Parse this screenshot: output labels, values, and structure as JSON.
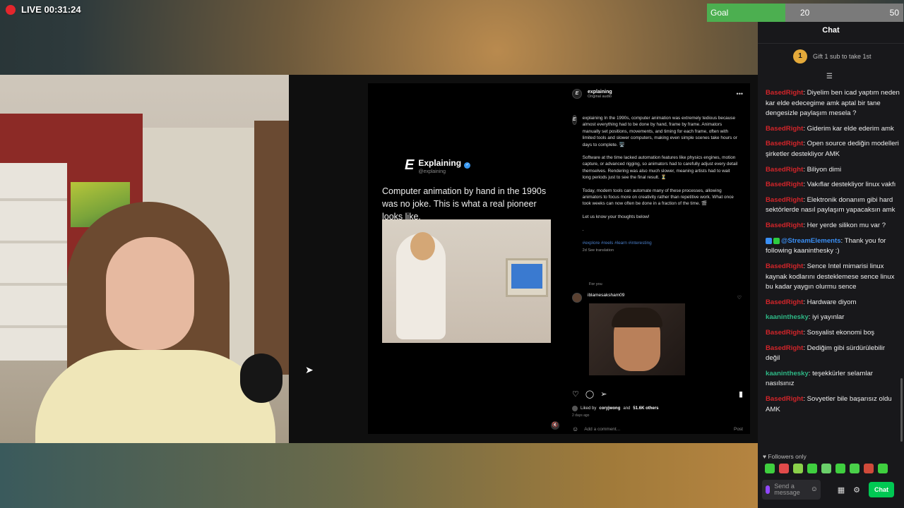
{
  "live": {
    "text": "LIVE 00:31:24",
    "color": "#e3262c"
  },
  "goal": {
    "label": "Goal",
    "current": "20",
    "max": "50",
    "progress": 0.4,
    "color": "#4caf50"
  },
  "instagram": {
    "reel": {
      "brand_logo": "E",
      "brand_name": "Explaining",
      "brand_handle": "@explaining",
      "caption": "Computer animation by hand in the 1990s was no joke. This is what a real pioneer looks like."
    },
    "post": {
      "user": "explaining",
      "audio": "Original audio",
      "paragraphs": [
        "explaining In the 1990s, computer animation was extremely tedious because almost everything had to be done by hand, frame by frame. Animators manually set positions, movements, and timing for each frame, often with limited tools and slower computers, making even simple scenes take hours or days to complete. 🖥️",
        "Software at the time lacked automation features like physics engines, motion capture, or advanced rigging, so animators had to carefully adjust every detail themselves. Rendering was also much slower, meaning artists had to wait long periods just to see the final result. ⏳",
        "Today, modern tools can automate many of these processes, allowing animators to focus more on creativity rather than repetitive work. What once took weeks can now often be done in a fraction of the time. 🎬",
        "Let us know your thoughts below!",
        "."
      ],
      "tags": "#explore #reels #learn #interesting",
      "meta": "2d   See translation",
      "for_you": "For you",
      "reply_user": "iblamesaksham09",
      "liked_prefix": "Liked by",
      "liked_user": "coryjwong",
      "liked_and": "and",
      "liked_others": "51.6K others",
      "date": "2 days ago",
      "comment_placeholder": "Add a comment...",
      "post_label": "Post"
    }
  },
  "chat": {
    "title": "Chat",
    "gift_rank": "1",
    "gift_text": "Gift 1 sub to take 1st",
    "messages": [
      {
        "user": "BasedRight",
        "color": "red",
        "text": "Diyelim ben icad yaptım neden kar elde edecegime amk aptal bir tane dengesizle paylaşım mesela ?"
      },
      {
        "user": "BasedRight",
        "color": "red",
        "text": "Giderim kar elde ederim amk"
      },
      {
        "user": "BasedRight",
        "color": "red",
        "text": "Open source dediğin modelleri şirketler destekliyor AMK"
      },
      {
        "user": "BasedRight",
        "color": "red",
        "text": "Biliyon dimi"
      },
      {
        "user": "BasedRight",
        "color": "red",
        "text": "Vakıflar destekliyor linux vakfı"
      },
      {
        "user": "BasedRight",
        "color": "red",
        "text": "Elektronik donanım gibi hard sektörlerde nasıl paylaşım yapacaksın amk"
      },
      {
        "user": "BasedRight",
        "color": "red",
        "text": "Her yerde silikon mu var ?"
      },
      {
        "user": "@StreamElements",
        "color": "blue",
        "text": "Thank you for following kaaninthesky :)"
      },
      {
        "user": "BasedRight",
        "color": "red",
        "text": "Sence Intel mimarisi linux kaynak kodlarını desteklemese sence linux bu kadar yaygın olurmu sence"
      },
      {
        "user": "BasedRight",
        "color": "red",
        "text": "Hardware diyom"
      },
      {
        "user": "kaaninthesky",
        "color": "green",
        "text": "iyi yayınlar"
      },
      {
        "user": "BasedRight",
        "color": "red",
        "text": "Sosyalist ekonomi boş"
      },
      {
        "user": "BasedRight",
        "color": "red",
        "text": "Dediğim gibi sürdürülebilir değil"
      },
      {
        "user": "kaaninthesky",
        "color": "green",
        "text": "teşekkürler selamlar nasılsınız"
      },
      {
        "user": "BasedRight",
        "color": "red",
        "text": "Sovyetler bile başarısız oldu AMK"
      }
    ],
    "followers_only": "Followers only",
    "send_placeholder": "Send a message",
    "chat_button": "Chat"
  },
  "icons": {
    "live": "record-dot-icon",
    "pin": "pin-icon",
    "heart": "heart-icon",
    "comment": "comment-icon",
    "share": "share-icon",
    "bookmark": "bookmark-icon",
    "emoji": "emoji-icon",
    "mic": "mic-icon",
    "settings": "gear-icon"
  }
}
